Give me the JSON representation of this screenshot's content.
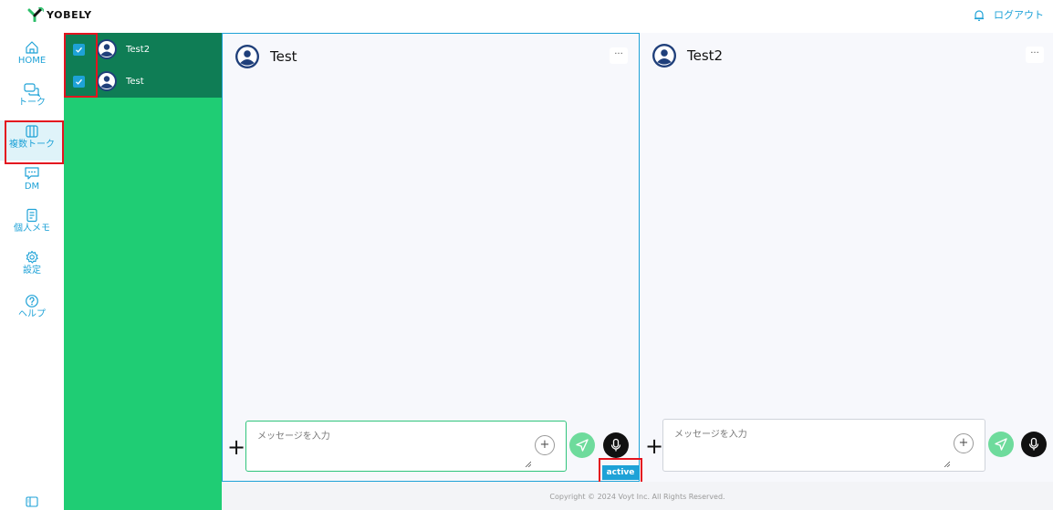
{
  "app": {
    "logo_text": "YOBELY",
    "logout_label": "ログアウト"
  },
  "nav": {
    "items": [
      {
        "label": "HOME",
        "icon": "home-icon"
      },
      {
        "label": "トーク",
        "icon": "chat-icon"
      },
      {
        "label": "複数トーク",
        "icon": "columns-icon",
        "active": true
      },
      {
        "label": "DM",
        "icon": "message-dots-icon"
      },
      {
        "label": "個人メモ",
        "icon": "memo-icon"
      },
      {
        "label": "設定",
        "icon": "gear-icon"
      },
      {
        "label": "ヘルプ",
        "icon": "help-icon"
      }
    ],
    "bottom_icon": "sidebar-toggle-icon"
  },
  "rooms": [
    {
      "name": "Test2",
      "checked": true
    },
    {
      "name": "Test",
      "checked": true
    }
  ],
  "panels": [
    {
      "title": "Test",
      "more": "···",
      "placeholder": "メッセージを入力",
      "active": true
    },
    {
      "title": "Test2",
      "more": "···",
      "placeholder": "メッセージを入力",
      "active": false
    }
  ],
  "composer": {
    "add_label": "+",
    "attach_label": "+"
  },
  "active_label": "active",
  "footer": {
    "copyright": "Copyright © 2024 Voyt Inc. All Rights Reserved."
  },
  "colors": {
    "accent": "#1ea2d7",
    "room_list_bg": "#1fcd74",
    "room_selected_bg": "#0f7d55",
    "highlight": "#e3141f"
  }
}
